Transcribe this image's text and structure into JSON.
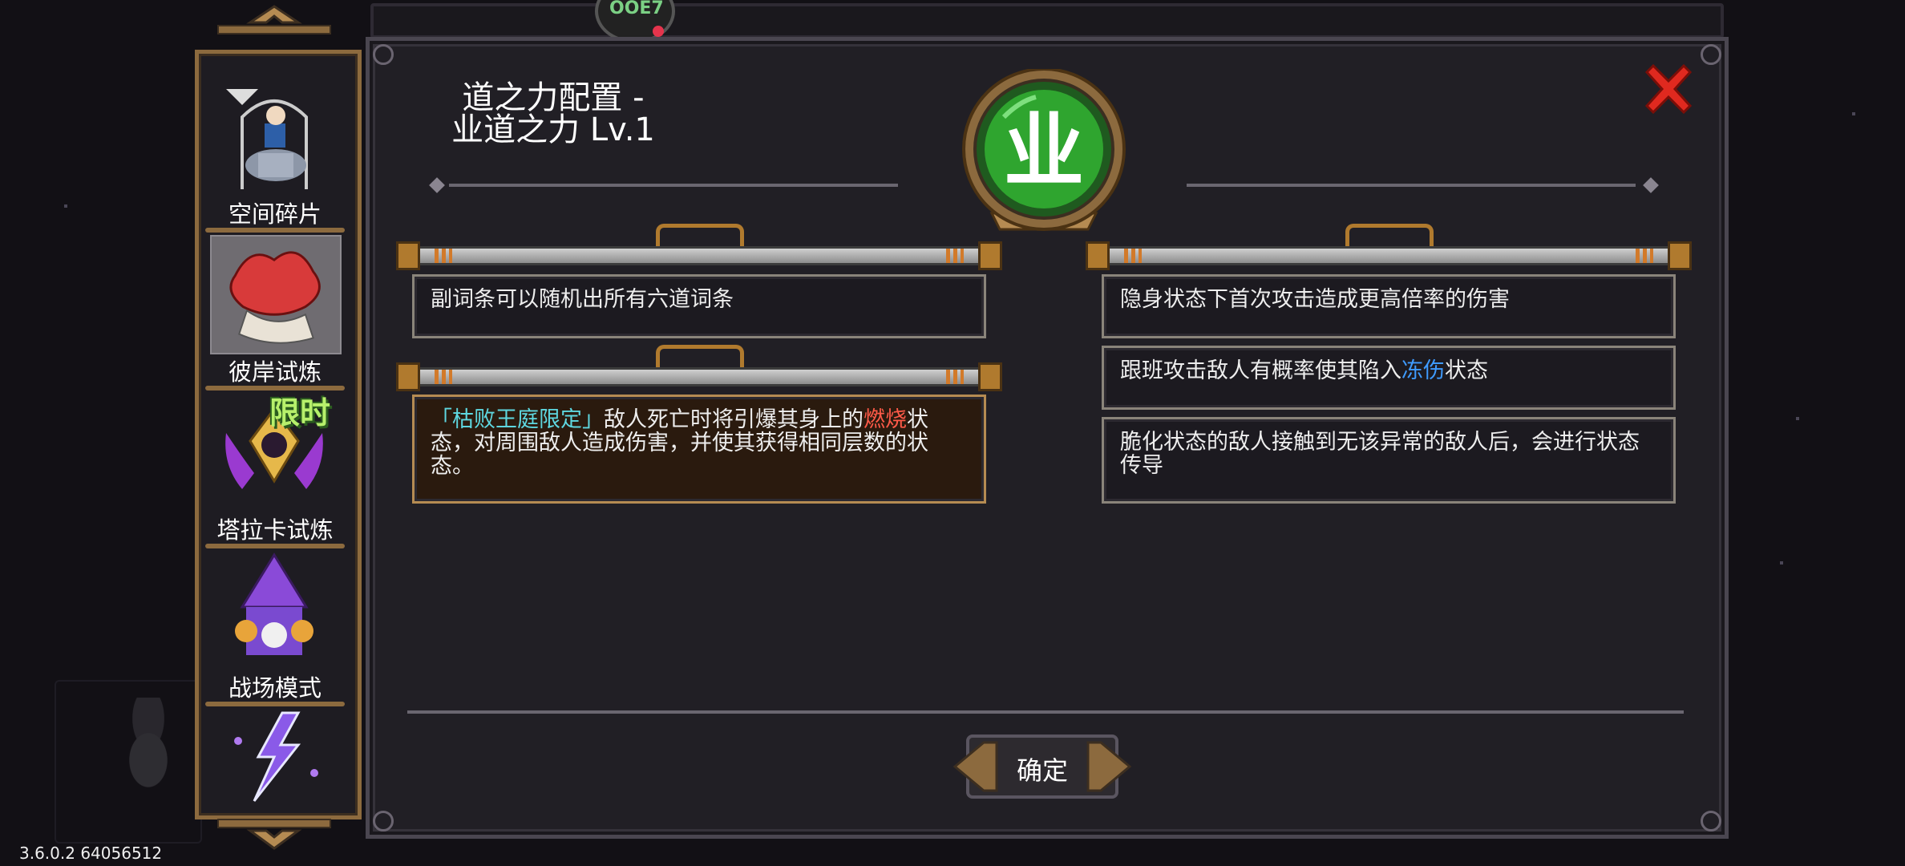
{
  "sidebar": {
    "items": [
      {
        "label": "空间碎片",
        "icon": "space-fragment-icon"
      },
      {
        "label": "彼岸试炼",
        "icon": "other-shore-trial-icon"
      },
      {
        "label": "塔拉卡试炼",
        "icon": "taraka-trial-icon",
        "badge": "限时"
      },
      {
        "label": "战场模式",
        "icon": "battlefield-mode-icon"
      },
      {
        "label": "",
        "icon": "lightning-mode-icon"
      }
    ]
  },
  "dialog": {
    "title_line1": "道之力配置 -",
    "title_line2": "业道之力 Lv.1",
    "emblem_glyph": "业",
    "left_descriptions": [
      {
        "text": "副词条可以随机出所有六道词条"
      },
      {
        "tag": "「枯败王庭限定」",
        "pre": "敌人死亡时将引爆其身上的",
        "highlight": "燃烧",
        "post": "状态，对周围敌人造成伤害，并使其获得相同层数的状态。"
      }
    ],
    "right_descriptions": [
      {
        "text": "隐身状态下首次攻击造成更高倍率的伤害"
      },
      {
        "pre": "跟班攻击敌人有概率使其陷入",
        "highlight": "冻伤",
        "post": "状态"
      },
      {
        "text": "脆化状态的敌人接触到无该异常的敌人后，会进行状态传导"
      }
    ],
    "confirm_label": "确定"
  },
  "version": "3.6.0.2 64056512",
  "colors": {
    "tag": "#5ed7e0",
    "burn": "#ff5a48",
    "frost": "#3f9bff",
    "emblem_green": "#2fa52f",
    "close_red": "#e0291f",
    "gold_frame": "#8c6a3e"
  }
}
